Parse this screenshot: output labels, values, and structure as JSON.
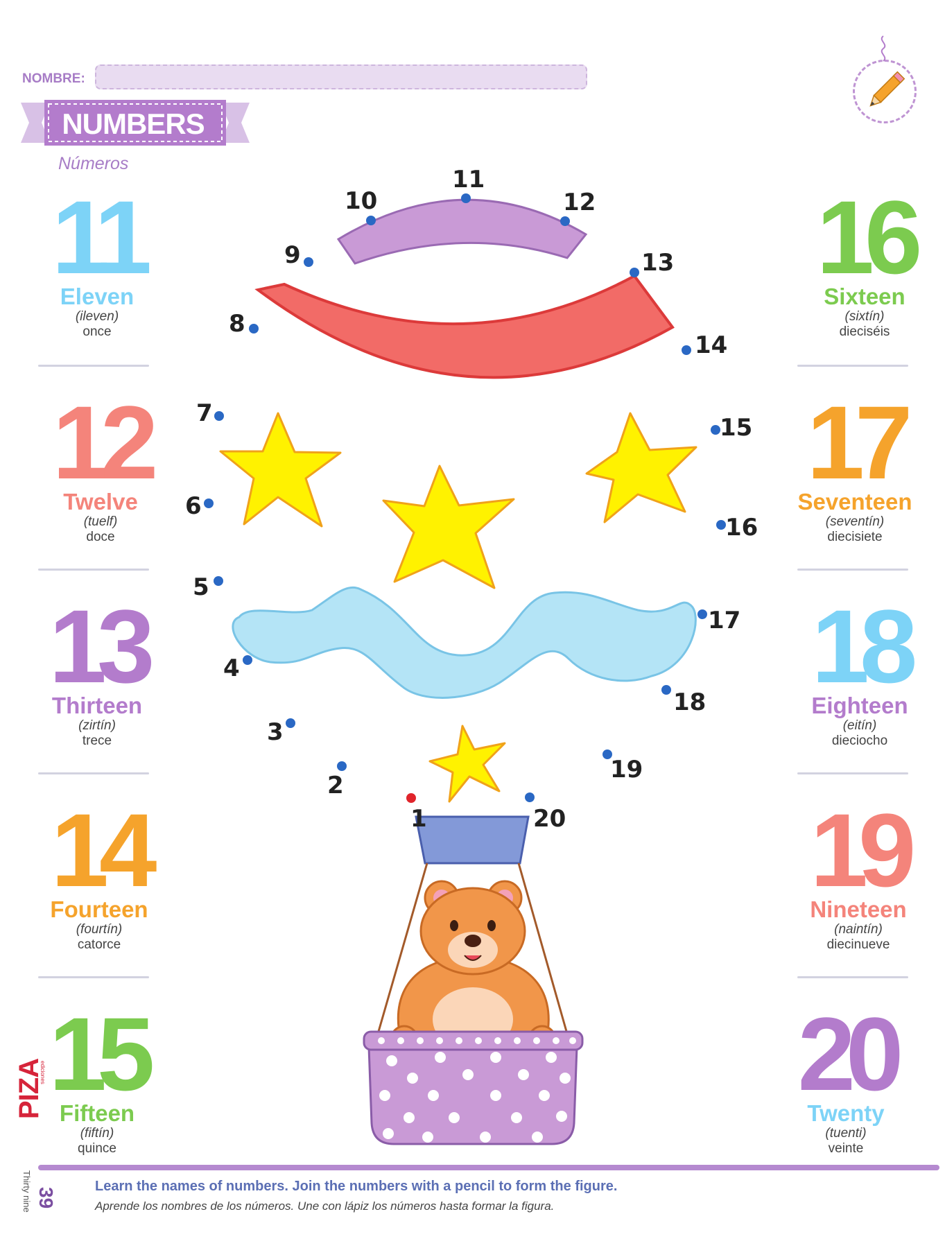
{
  "header": {
    "nombre_label": "NOMBRE:",
    "title": "NUMBERS",
    "subtitle": "Números",
    "badge_icon": "pencil-icon"
  },
  "colors": {
    "purple": "#b37ccc",
    "blue": "#7dd3f7",
    "salmon": "#f4847b",
    "orange": "#f5a32c",
    "green": "#7ccb4f",
    "dot_blue": "#2a68c4",
    "dot_start": "#e0242b"
  },
  "numbers_left": [
    {
      "num": "11",
      "word": "Eleven",
      "pron": "(ileven)",
      "es": "once",
      "color": "#7dd3f7"
    },
    {
      "num": "12",
      "word": "Twelve",
      "pron": "(tuelf)",
      "es": "doce",
      "color": "#f4847b"
    },
    {
      "num": "13",
      "word": "Thirteen",
      "pron": "(zirtín)",
      "es": "trece",
      "color": "#b37ccc"
    },
    {
      "num": "14",
      "word": "Fourteen",
      "pron": "(fourtín)",
      "es": "catorce",
      "color": "#f5a32c"
    },
    {
      "num": "15",
      "word": "Fifteen",
      "pron": "(fiftín)",
      "es": "quince",
      "color": "#7ccb4f"
    }
  ],
  "numbers_right": [
    {
      "num": "16",
      "word": "Sixteen",
      "pron": "(sixtín)",
      "es": "dieciséis",
      "color": "#7ccb4f"
    },
    {
      "num": "17",
      "word": "Seventeen",
      "pron": "(seventín)",
      "es": "diecisiete",
      "color": "#f5a32c"
    },
    {
      "num": "18",
      "word": "Eighteen",
      "pron": "(eitín)",
      "es": "dieciocho",
      "color": "#7dd3f7",
      "word_color": "#b37ccc"
    },
    {
      "num": "19",
      "word": "Nineteen",
      "pron": "(naintín)",
      "es": "diecinueve",
      "color": "#f4847b"
    },
    {
      "num": "20",
      "word": "Twenty",
      "pron": "(tuenti)",
      "es": "veinte",
      "color": "#b37ccc",
      "word_color": "#7dd3f7"
    }
  ],
  "dots": [
    "1",
    "2",
    "3",
    "4",
    "5",
    "6",
    "7",
    "8",
    "9",
    "10",
    "11",
    "12",
    "13",
    "14",
    "15",
    "16",
    "17",
    "18",
    "19",
    "20"
  ],
  "footer": {
    "page_number": "39",
    "page_words": "Thirty nine",
    "instruction_en": "Learn the names of numbers. Join the numbers with a pencil to form the figure.",
    "instruction_es": "Aprende los nombres de los números. Une con lápiz los números hasta formar la figura.",
    "logo_text": "PIZA",
    "logo_sub": "ediciones"
  }
}
